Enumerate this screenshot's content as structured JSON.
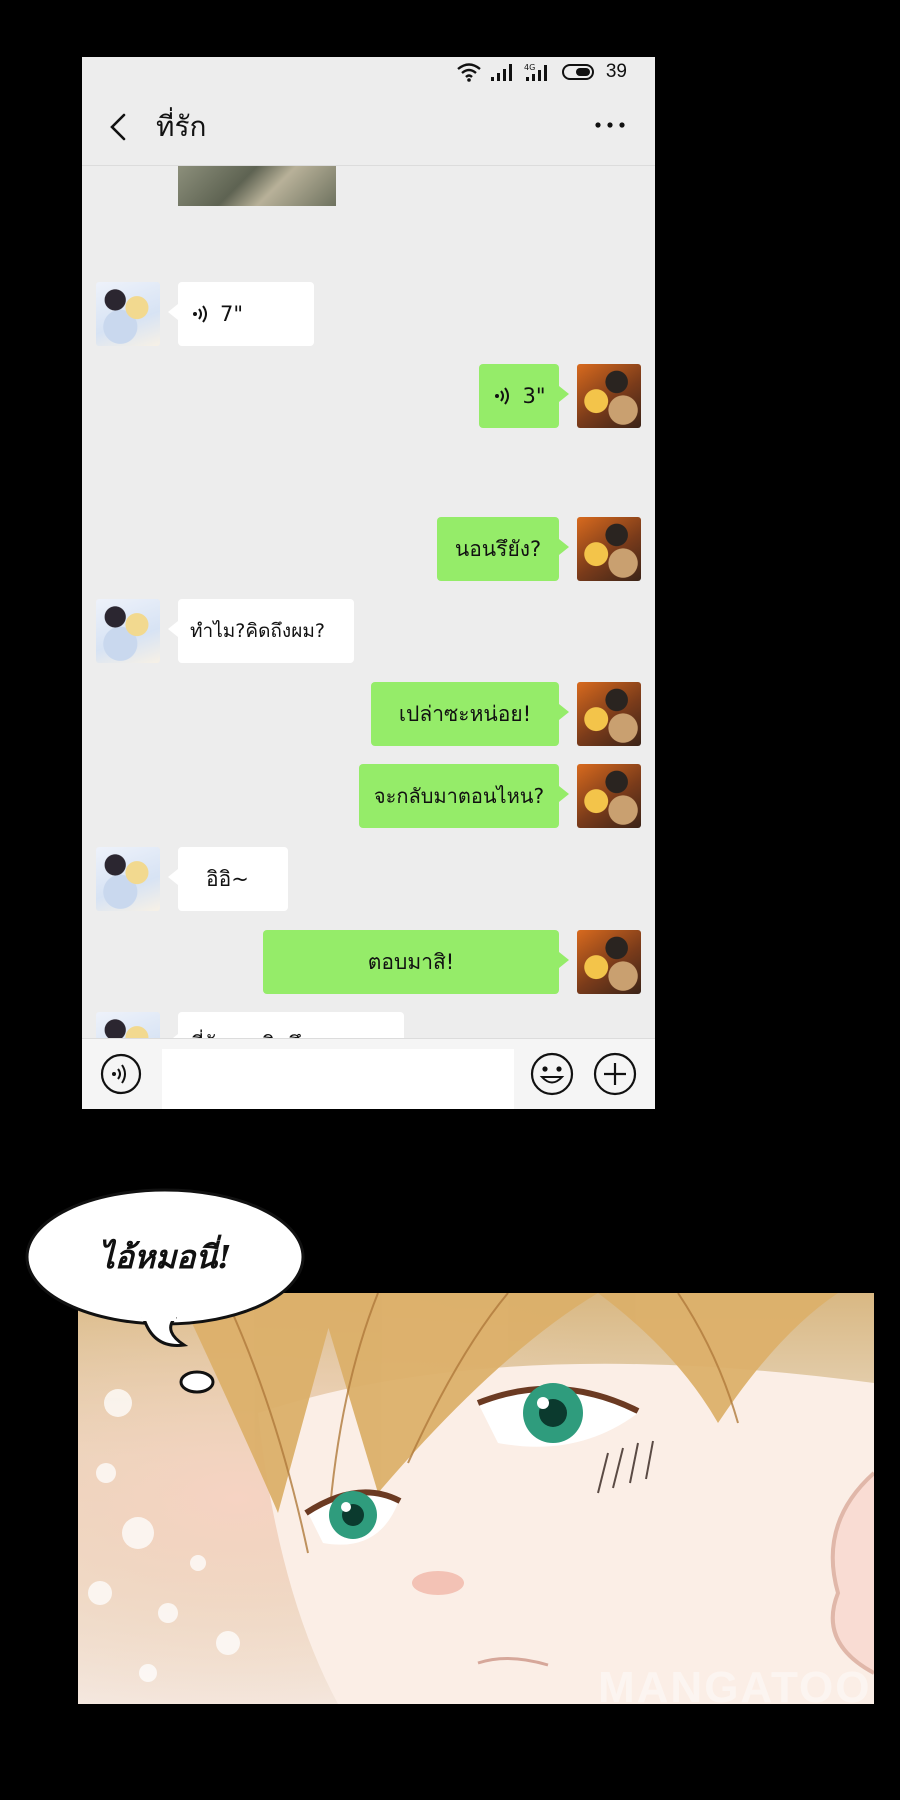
{
  "status_bar": {
    "battery_level": "39",
    "icons": [
      "wifi-icon",
      "signal-icon",
      "4g-signal-icon",
      "battery-icon"
    ]
  },
  "header": {
    "title": "ที่รัก",
    "back_icon": "chevron-left-icon",
    "more_icon": "more-dots-icon"
  },
  "messages": [
    {
      "side": "left",
      "type": "voice",
      "text": "7\""
    },
    {
      "side": "right",
      "type": "voice",
      "text": "3\""
    },
    {
      "side": "right",
      "type": "text",
      "text": "นอนรึยัง?"
    },
    {
      "side": "left",
      "type": "text",
      "text": "ทำไม?คิดถึงผม?"
    },
    {
      "side": "right",
      "type": "text",
      "text": "เปล่าซะหน่อย!"
    },
    {
      "side": "right",
      "type": "text",
      "text": "จะกลับมาตอนไหน?"
    },
    {
      "side": "left",
      "type": "text",
      "text": "อิอิ~"
    },
    {
      "side": "right",
      "type": "text",
      "text": "ตอบมาสิ!"
    },
    {
      "side": "left",
      "type": "text",
      "text": "ที่รัก ผมคิดถึงคุณนะ"
    }
  ],
  "input_bar": {
    "value": "",
    "icons": [
      "voice-input-icon",
      "emoji-icon",
      "plus-icon"
    ]
  },
  "comic": {
    "speech": "ไอ้หมอนี่!",
    "watermark": "MANGATOON"
  },
  "colors": {
    "sent_bubble": "#95ec69",
    "received_bubble": "#ffffff",
    "chat_background": "#ededed"
  }
}
